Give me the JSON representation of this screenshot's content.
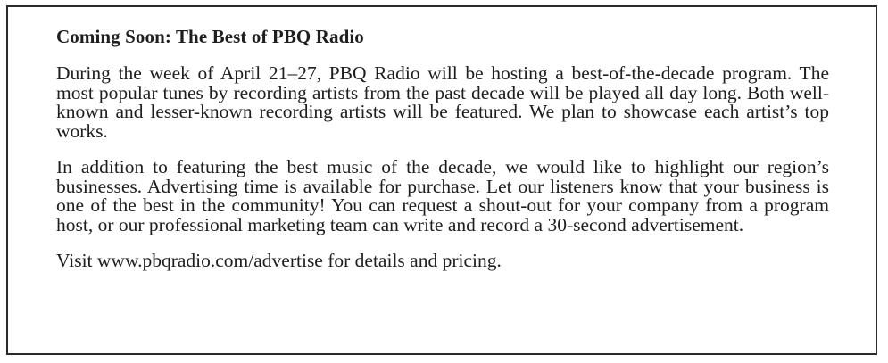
{
  "notice": {
    "title": "Coming Soon: The Best of PBQ Radio",
    "paragraphs": [
      "During the week of April 21–27, PBQ Radio will be hosting a best-of-the-decade program. The most popular tunes by recording artists from the past decade will be played all day long. Both well-known and lesser-known recording artists will be featured. We plan to showcase each artist’s top works.",
      "In addition to featuring the best music of the decade, we would like to highlight our region’s businesses. Advertising time is available for purchase. Let our listeners know that your business is one of the best in the community! You can request a shout-out for your company from a program host, or our professional marketing team can write and record a 30-second advertisement.",
      "Visit www.pbqradio.com/advertise for details and pricing."
    ]
  }
}
